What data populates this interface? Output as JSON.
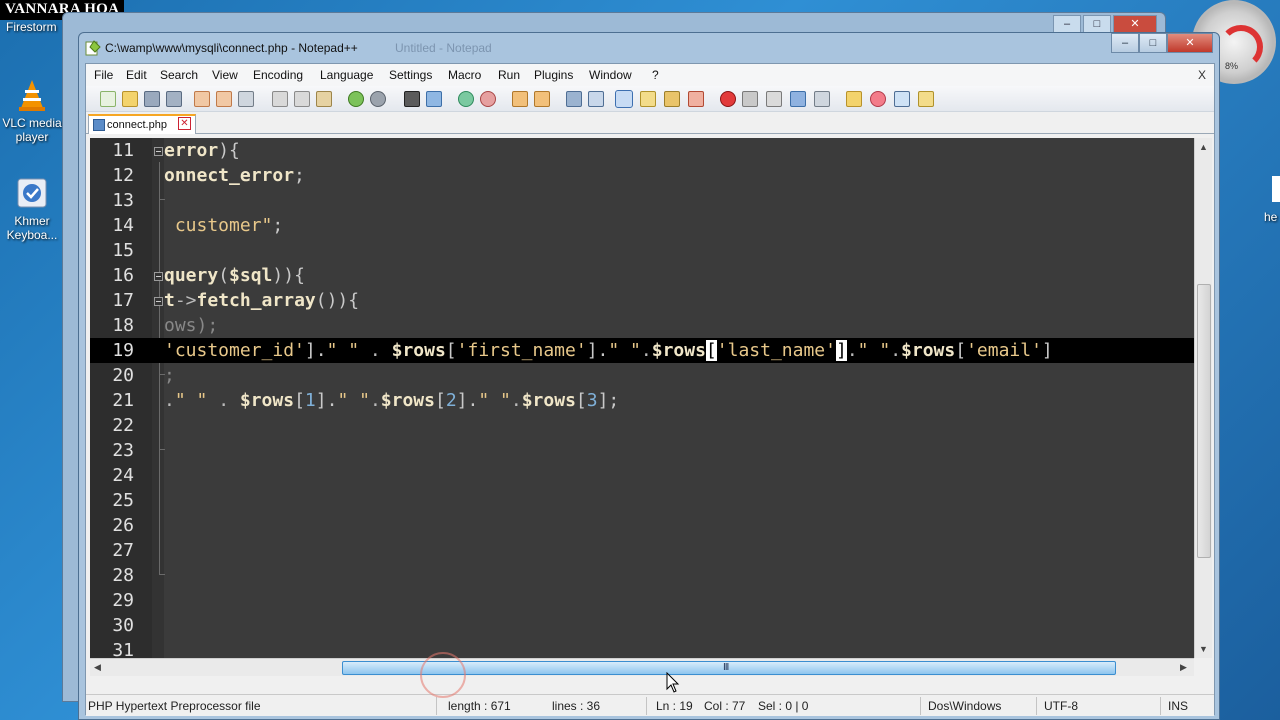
{
  "desktop": {
    "watermark": "VANNARA HOA",
    "firestorm": "Firestorm",
    "icons": [
      {
        "label": "VLC media player",
        "icon": "vlc-cone-icon"
      },
      {
        "label": "Khmer Keyboa...",
        "icon": "keyboard-app-icon"
      }
    ],
    "edge_label": "he",
    "gauge_pct": "8%"
  },
  "window": {
    "title": "C:\\wamp\\www\\mysqli\\connect.php - Notepad++",
    "ghost_title": "Untitled - Notepad",
    "controls": {
      "minimize": "–",
      "maximize": "□",
      "close": "✕"
    }
  },
  "menu": {
    "items": [
      "File",
      "Edit",
      "Search",
      "View",
      "Encoding",
      "Language",
      "Settings",
      "Macro",
      "Run",
      "Plugins",
      "Window",
      "?"
    ],
    "close": "X"
  },
  "tab": {
    "label": "connect.php",
    "close": "✕"
  },
  "editor": {
    "lines": [
      {
        "n": "11",
        "text": "error){"
      },
      {
        "n": "12",
        "text": "onnect_error;"
      },
      {
        "n": "13",
        "text": ""
      },
      {
        "n": "14",
        "text": " customer\";"
      },
      {
        "n": "15",
        "text": ""
      },
      {
        "n": "16",
        "text": "query($sql)){"
      },
      {
        "n": "17",
        "text": "t->fetch_array()){"
      },
      {
        "n": "18",
        "text": "ows);"
      },
      {
        "n": "19",
        "text": "'customer_id'].\" \" . $rows['first_name'].\" \".$rows['last_name'].\" \".$rows['email']"
      },
      {
        "n": "20",
        "text": ";"
      },
      {
        "n": "21",
        "text": ".\" \" . $rows[1].\" \".$rows[2].\" \".$rows[3];"
      },
      {
        "n": "22",
        "text": ""
      },
      {
        "n": "23",
        "text": ""
      },
      {
        "n": "24",
        "text": ""
      },
      {
        "n": "25",
        "text": ""
      },
      {
        "n": "26",
        "text": ""
      },
      {
        "n": "27",
        "text": ""
      },
      {
        "n": "28",
        "text": ""
      },
      {
        "n": "29",
        "text": ""
      },
      {
        "n": "30",
        "text": ""
      },
      {
        "n": "31",
        "text": ""
      }
    ],
    "highlighted_line": "19"
  },
  "scrollbar": {
    "grip": "III"
  },
  "status": {
    "file_type": "PHP Hypertext Preprocessor file",
    "length": "length : 671",
    "lines": "lines : 36",
    "ln": "Ln : 19",
    "col": "Col : 77",
    "sel": "Sel : 0 | 0",
    "eol": "Dos\\Windows",
    "encoding": "UTF-8",
    "mode": "INS"
  },
  "colors": {
    "editor_bg": "#3b3b3b",
    "gutter_bg": "#2d2d2d",
    "current_line": "#000000",
    "string": "#e8c88a",
    "keyword": "#f0e6c8",
    "number": "#7fb0d8",
    "tab_accent": "#f6a623",
    "scroll_thumb": "#8ec5ef"
  }
}
